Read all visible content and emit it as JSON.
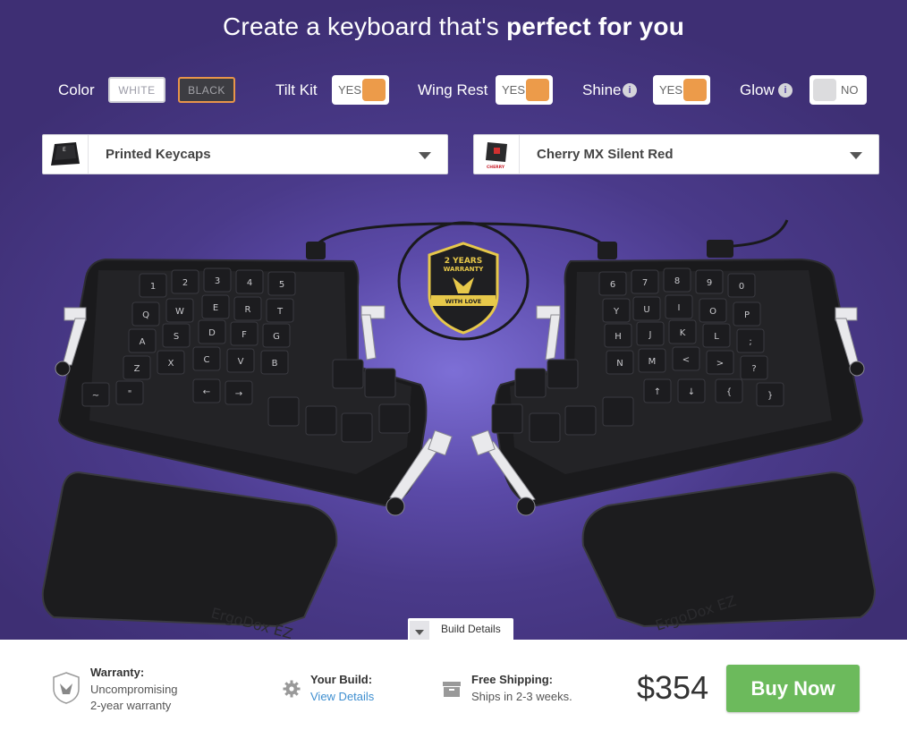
{
  "headline": {
    "prefix": "Create a keyboard that's ",
    "emphasis": "perfect for you"
  },
  "options": {
    "color": {
      "label": "Color",
      "white": "WHITE",
      "black": "BLACK",
      "selected": "BLACK"
    },
    "tilt_kit": {
      "label": "Tilt Kit",
      "value": "YES"
    },
    "wing_rest": {
      "label": "Wing Rest",
      "value": "YES"
    },
    "shine": {
      "label": "Shine",
      "info": "i",
      "value": "YES"
    },
    "glow": {
      "label": "Glow",
      "info": "i",
      "value": "NO"
    }
  },
  "selects": {
    "keycaps": {
      "value": "Printed Keycaps",
      "icon": "keycap-icon"
    },
    "switches": {
      "value": "Cherry MX Silent Red",
      "icon": "cherry-switch-icon"
    }
  },
  "badge": {
    "line1": "2 YEARS",
    "line2": "WARRANTY",
    "line3": "WITH LOVE"
  },
  "keyboard": {
    "brand_text": "ErgoDox EZ",
    "left_keys": [
      "1",
      "2",
      "3",
      "4",
      "5",
      "Q",
      "W",
      "E",
      "R",
      "T",
      "A",
      "S",
      "D",
      "F",
      "G",
      "Z",
      "X",
      "C",
      "V",
      "B",
      "~",
      "\"",
      "←",
      "→"
    ],
    "right_keys": [
      "6",
      "7",
      "8",
      "9",
      "0",
      "Y",
      "U",
      "I",
      "O",
      "P",
      "H",
      "J",
      "K",
      "L",
      ";",
      "N",
      "M",
      "<",
      ">",
      "?",
      "↑",
      "↓",
      "{",
      "}"
    ]
  },
  "build_tab": {
    "label": "Build Details"
  },
  "footer": {
    "warranty_title": "Warranty:",
    "warranty_line1": "Uncompromising",
    "warranty_line2": "2-year warranty",
    "build_title": "Your Build:",
    "build_link": "View Details",
    "shipping_title": "Free Shipping:",
    "shipping_text": "Ships in 2-3 weeks.",
    "price": "$354",
    "buy_label": "Buy Now"
  },
  "colors": {
    "accent_orange": "#ec9b4a",
    "buy_green": "#6cba5c",
    "link_blue": "#3f8fd0",
    "bg_purple": "#4a3a8a"
  }
}
